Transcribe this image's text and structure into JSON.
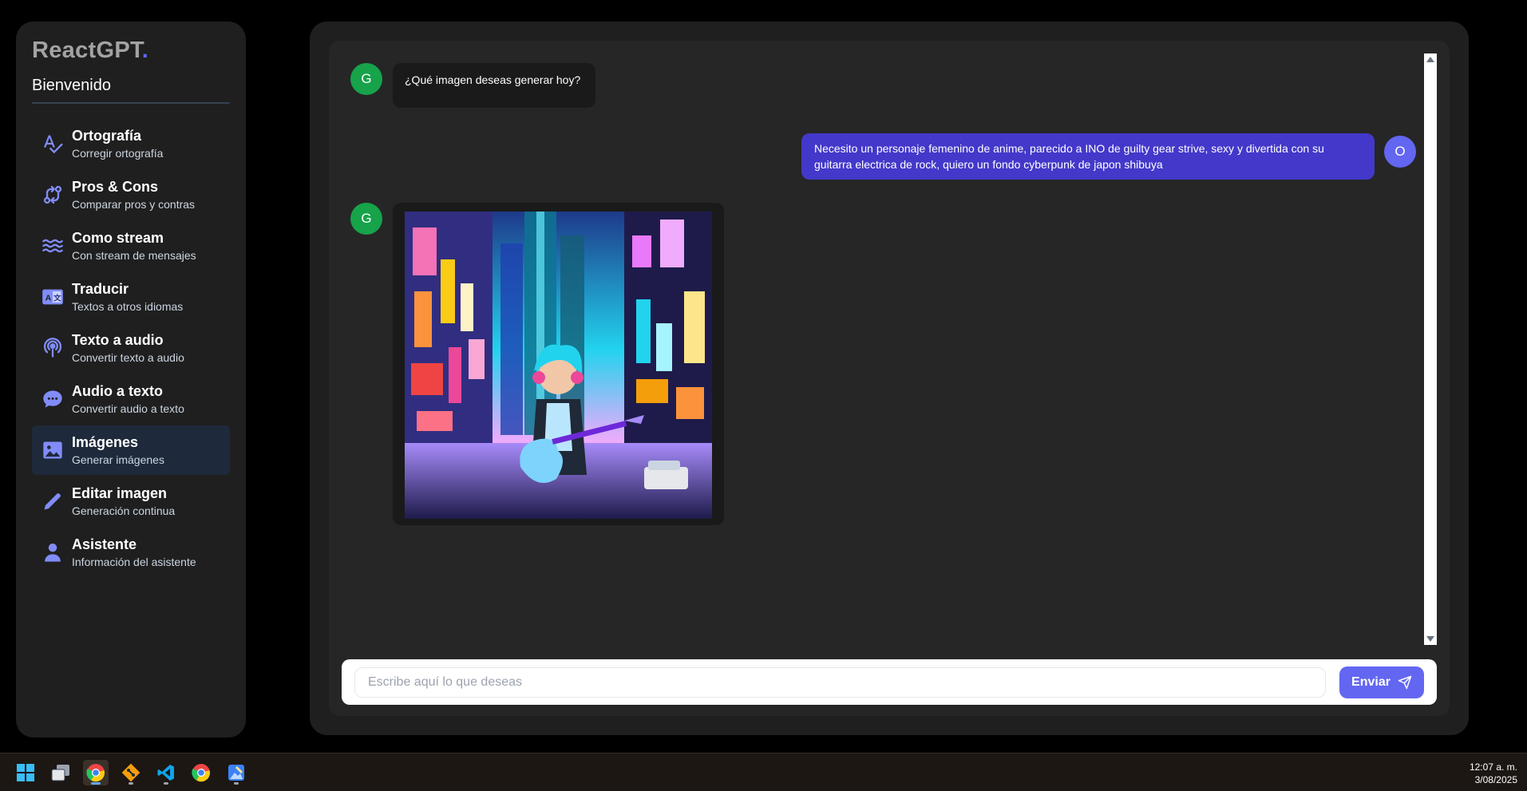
{
  "sidebar": {
    "logo": "ReactGPT",
    "logo_dot": ".",
    "welcome": "Bienvenido",
    "items": [
      {
        "title": "Ortografía",
        "subtitle": "Corregir ortografía",
        "icon": "spellcheck-icon",
        "active": false
      },
      {
        "title": "Pros & Cons",
        "subtitle": "Comparar pros y contras",
        "icon": "compare-arrows-icon",
        "active": false
      },
      {
        "title": "Como stream",
        "subtitle": "Con stream de mensajes",
        "icon": "waves-icon",
        "active": false
      },
      {
        "title": "Traducir",
        "subtitle": "Textos a otros idiomas",
        "icon": "translate-icon",
        "active": false
      },
      {
        "title": "Texto a audio",
        "subtitle": "Convertir texto a audio",
        "icon": "podcast-icon",
        "active": false
      },
      {
        "title": "Audio a texto",
        "subtitle": "Convertir audio a texto",
        "icon": "chat-bubble-icon",
        "active": false
      },
      {
        "title": "Imágenes",
        "subtitle": "Generar imágenes",
        "icon": "image-icon",
        "active": true
      },
      {
        "title": "Editar imagen",
        "subtitle": "Generación continua",
        "icon": "pencil-icon",
        "active": false
      },
      {
        "title": "Asistente",
        "subtitle": "Información del asistente",
        "icon": "user-icon",
        "active": false
      }
    ]
  },
  "chat": {
    "messages": [
      {
        "role": "assistant",
        "avatar": "G",
        "text": "¿Qué imagen deseas generar hoy?"
      },
      {
        "role": "user",
        "avatar": "O",
        "text": "Necesito un personaje femenino de anime, parecido a INO de guilty gear strive, sexy y divertida con su guitarra electrica de rock, quiero un fondo cyberpunk de japon shibuya"
      },
      {
        "role": "assistant",
        "avatar": "G",
        "image": "generated-anime-guitarist-shibuya"
      }
    ]
  },
  "input": {
    "placeholder": "Escribe aquí lo que deseas",
    "value": "",
    "send_label": "Enviar"
  },
  "taskbar": {
    "apps": [
      "windows-start-icon",
      "task-view-icon",
      "chrome-icon",
      "git-icon",
      "vscode-icon",
      "chrome-icon",
      "paint-icon"
    ],
    "time": "12:07 a. m.",
    "date": "3/08/2025"
  },
  "colors": {
    "accent": "#6366f1",
    "user_bubble": "#4338ca",
    "assistant_avatar": "#16a34a",
    "panel": "#1f1f1f",
    "active_item": "#1e293b"
  }
}
